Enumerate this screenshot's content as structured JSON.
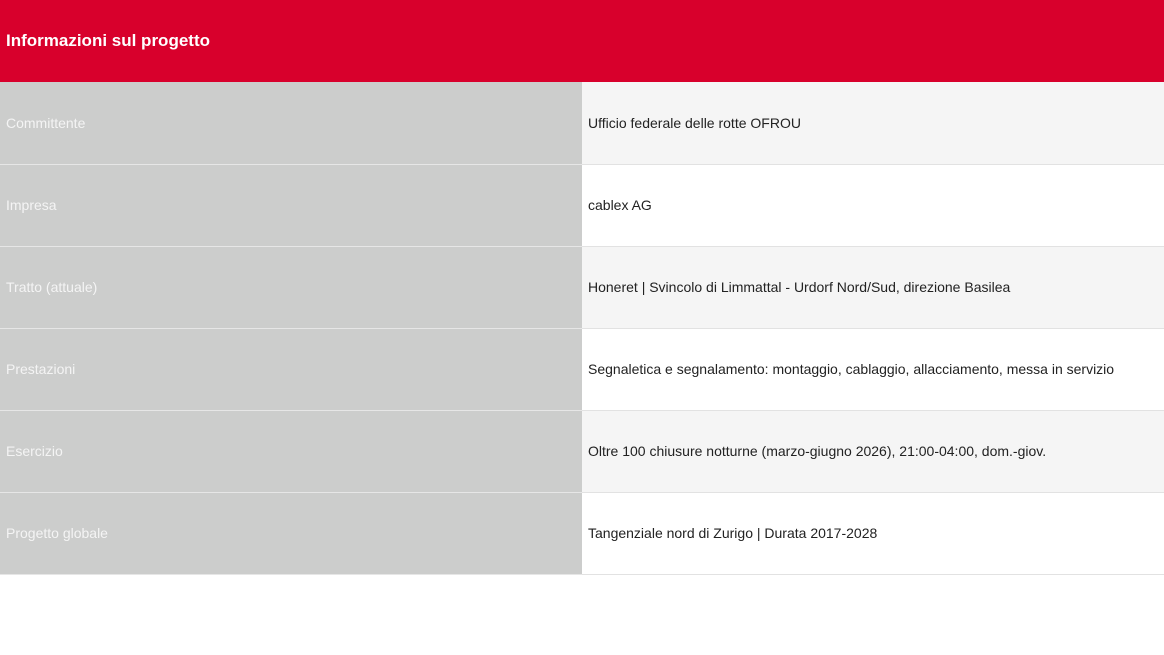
{
  "table": {
    "header": "Informazioni sul progetto",
    "rows": [
      {
        "label": "Committente",
        "value": "Ufficio federale delle rotte OFROU"
      },
      {
        "label": "Impresa",
        "value": "cablex AG"
      },
      {
        "label": "Tratto (attuale)",
        "value": "Honeret | Svincolo di Limmattal - Urdorf Nord/Sud, direzione Basilea"
      },
      {
        "label": "Prestazioni",
        "value": "Segnaletica e segnalamento: montaggio, cablaggio, allacciamento, messa in servizio"
      },
      {
        "label": "Esercizio",
        "value": "Oltre 100 chiusure notturne (marzo-giugno 2026), 21:00-04:00, dom.-giov."
      },
      {
        "label": "Progetto globale",
        "value": "Tangenziale nord di Zurigo | Durata 2017-2028"
      }
    ]
  },
  "colors": {
    "header_background": "#d8002c",
    "label_background": "#cccdcc",
    "row_alt_background": "#f5f5f5"
  }
}
